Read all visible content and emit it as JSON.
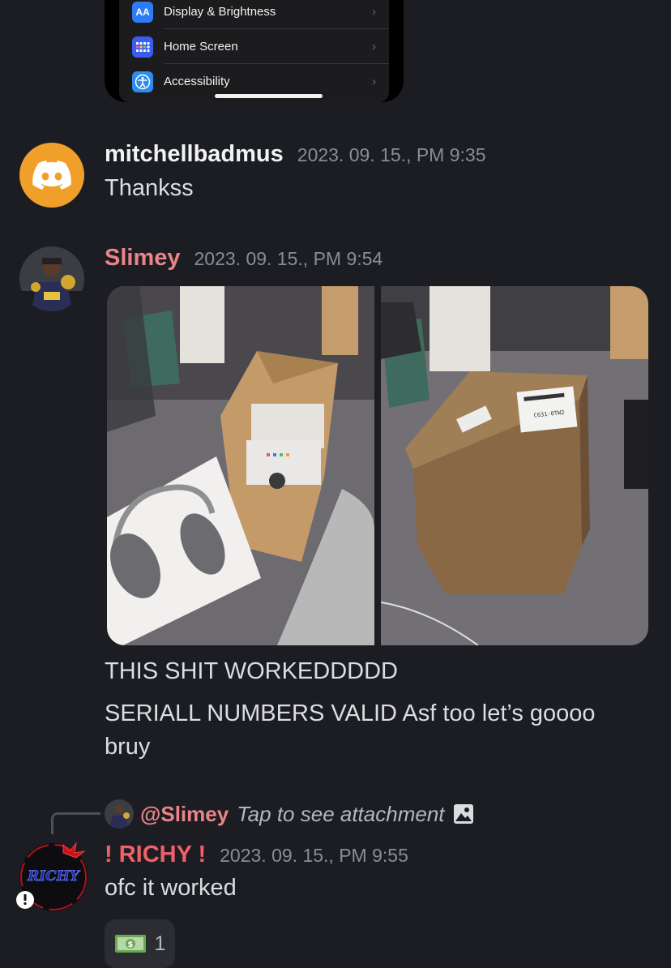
{
  "phone_screenshot": {
    "rows": [
      {
        "icon": "display-brightness-icon",
        "icon_text": "AA",
        "color": "#2d7cf6",
        "label": "Display & Brightness"
      },
      {
        "icon": "home-screen-icon",
        "icon_text": "",
        "color": "#3a5cf0",
        "label": "Home Screen"
      },
      {
        "icon": "accessibility-icon",
        "icon_text": "",
        "color": "#2d8cf0",
        "label": "Accessibility"
      }
    ]
  },
  "messages": [
    {
      "username": "mitchellbadmus",
      "username_color": "#f2f3f5",
      "timestamp": "2023. 09. 15., PM 9:35",
      "lines": [
        "Thankss"
      ]
    },
    {
      "username": "Slimey",
      "username_color": "#e8848a",
      "timestamp": "2023. 09. 15., PM 9:54",
      "lines": [
        "THIS SHIT WORKEDDDDD",
        "SERIALL NUMBERS VALID Asf too let’s goooo",
        "bruy"
      ]
    },
    {
      "username": "! RICHY !",
      "username_color": "#f0606a",
      "timestamp": "2023. 09. 15., PM 9:55",
      "lines": [
        "ofc it worked"
      ]
    }
  ],
  "reply": {
    "mention": "@Slimey",
    "text": "Tap to see attachment"
  },
  "avatar_richy_text": "RICHY",
  "reaction": {
    "emoji": "money-bag-icon",
    "count": "1"
  },
  "box_label": "C631-0TW2"
}
